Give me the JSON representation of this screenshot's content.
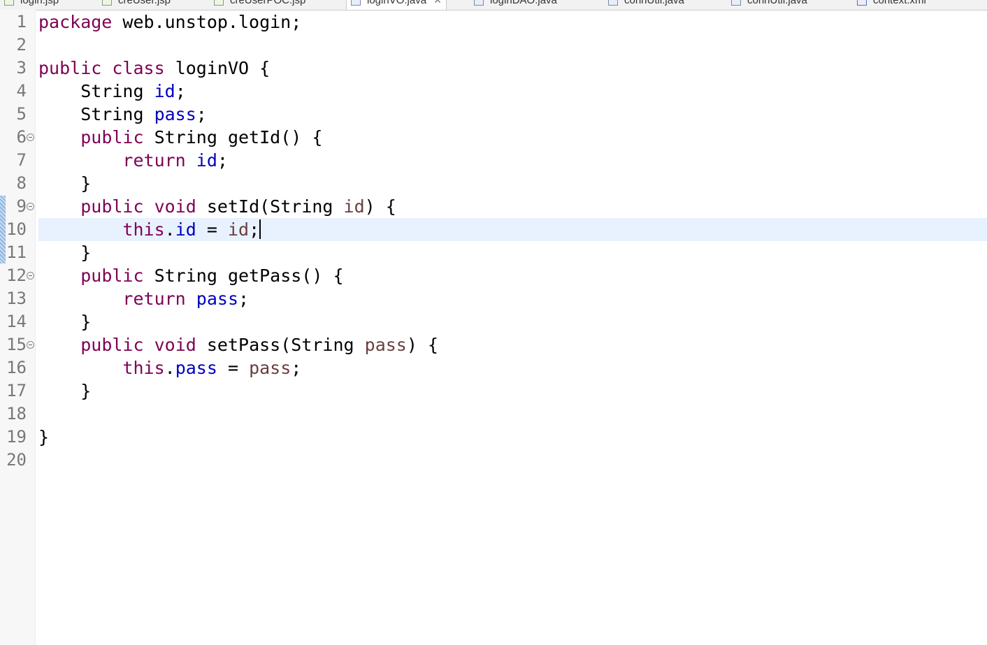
{
  "tabs": [
    {
      "label": "login.jsp",
      "type": "jsp",
      "active": false
    },
    {
      "label": "creUser.jsp",
      "type": "jsp",
      "active": false
    },
    {
      "label": "creUserPOC.jsp",
      "type": "jsp",
      "active": false
    },
    {
      "label": "loginVO.java",
      "type": "java",
      "active": true
    },
    {
      "label": "loginDAO.java",
      "type": "java",
      "active": false
    },
    {
      "label": "connUtil.java",
      "type": "java",
      "active": false
    },
    {
      "label": "connUtil.java",
      "type": "java",
      "active": false
    },
    {
      "label": "context.xml",
      "type": "xml",
      "active": false
    }
  ],
  "editor": {
    "current_line": 10,
    "lines": [
      {
        "n": "1",
        "fold": false,
        "tokens": [
          {
            "t": "package",
            "c": "kw"
          },
          {
            "t": " web.unstop.login;",
            "c": ""
          }
        ]
      },
      {
        "n": "2",
        "fold": false,
        "tokens": []
      },
      {
        "n": "3",
        "fold": false,
        "tokens": [
          {
            "t": "public",
            "c": "kw"
          },
          {
            "t": " ",
            "c": ""
          },
          {
            "t": "class",
            "c": "kw"
          },
          {
            "t": " loginVO {",
            "c": ""
          }
        ]
      },
      {
        "n": "4",
        "fold": false,
        "tokens": [
          {
            "t": "    String ",
            "c": ""
          },
          {
            "t": "id",
            "c": "fld"
          },
          {
            "t": ";",
            "c": ""
          }
        ]
      },
      {
        "n": "5",
        "fold": false,
        "tokens": [
          {
            "t": "    String ",
            "c": ""
          },
          {
            "t": "pass",
            "c": "fld"
          },
          {
            "t": ";",
            "c": ""
          }
        ]
      },
      {
        "n": "6",
        "fold": true,
        "tokens": [
          {
            "t": "    ",
            "c": ""
          },
          {
            "t": "public",
            "c": "kw"
          },
          {
            "t": " String getId() {",
            "c": ""
          }
        ]
      },
      {
        "n": "7",
        "fold": false,
        "tokens": [
          {
            "t": "        ",
            "c": ""
          },
          {
            "t": "return",
            "c": "kw"
          },
          {
            "t": " ",
            "c": ""
          },
          {
            "t": "id",
            "c": "fld"
          },
          {
            "t": ";",
            "c": ""
          }
        ]
      },
      {
        "n": "8",
        "fold": false,
        "tokens": [
          {
            "t": "    }",
            "c": ""
          }
        ]
      },
      {
        "n": "9",
        "fold": true,
        "tokens": [
          {
            "t": "    ",
            "c": ""
          },
          {
            "t": "public",
            "c": "kw"
          },
          {
            "t": " ",
            "c": ""
          },
          {
            "t": "void",
            "c": "kw"
          },
          {
            "t": " setId(String ",
            "c": ""
          },
          {
            "t": "id",
            "c": "param"
          },
          {
            "t": ") {",
            "c": ""
          }
        ]
      },
      {
        "n": "10",
        "fold": false,
        "tokens": [
          {
            "t": "        ",
            "c": ""
          },
          {
            "t": "this",
            "c": "kw"
          },
          {
            "t": ".",
            "c": ""
          },
          {
            "t": "id",
            "c": "fld"
          },
          {
            "t": " = ",
            "c": ""
          },
          {
            "t": "id",
            "c": "param"
          },
          {
            "t": ";",
            "c": ""
          }
        ]
      },
      {
        "n": "11",
        "fold": false,
        "tokens": [
          {
            "t": "    }",
            "c": ""
          }
        ]
      },
      {
        "n": "12",
        "fold": true,
        "tokens": [
          {
            "t": "    ",
            "c": ""
          },
          {
            "t": "public",
            "c": "kw"
          },
          {
            "t": " String getPass() {",
            "c": ""
          }
        ]
      },
      {
        "n": "13",
        "fold": false,
        "tokens": [
          {
            "t": "        ",
            "c": ""
          },
          {
            "t": "return",
            "c": "kw"
          },
          {
            "t": " ",
            "c": ""
          },
          {
            "t": "pass",
            "c": "fld"
          },
          {
            "t": ";",
            "c": ""
          }
        ]
      },
      {
        "n": "14",
        "fold": false,
        "tokens": [
          {
            "t": "    }",
            "c": ""
          }
        ]
      },
      {
        "n": "15",
        "fold": true,
        "tokens": [
          {
            "t": "    ",
            "c": ""
          },
          {
            "t": "public",
            "c": "kw"
          },
          {
            "t": " ",
            "c": ""
          },
          {
            "t": "void",
            "c": "kw"
          },
          {
            "t": " setPass(String ",
            "c": ""
          },
          {
            "t": "pass",
            "c": "param"
          },
          {
            "t": ") {",
            "c": ""
          }
        ]
      },
      {
        "n": "16",
        "fold": false,
        "tokens": [
          {
            "t": "        ",
            "c": ""
          },
          {
            "t": "this",
            "c": "kw"
          },
          {
            "t": ".",
            "c": ""
          },
          {
            "t": "pass",
            "c": "fld"
          },
          {
            "t": " = ",
            "c": ""
          },
          {
            "t": "pass",
            "c": "param"
          },
          {
            "t": ";",
            "c": ""
          }
        ]
      },
      {
        "n": "17",
        "fold": false,
        "tokens": [
          {
            "t": "    }",
            "c": ""
          }
        ]
      },
      {
        "n": "18",
        "fold": false,
        "tokens": []
      },
      {
        "n": "19",
        "fold": false,
        "tokens": [
          {
            "t": "}",
            "c": ""
          }
        ]
      },
      {
        "n": "20",
        "fold": false,
        "tokens": []
      }
    ]
  },
  "colors": {
    "keyword": "#7f0055",
    "field": "#0000c0",
    "parameter": "#6a3e3e",
    "current_line_highlight": "#e8f2fe"
  },
  "icons": {
    "tab_file": "java-file-icon",
    "tab_close": "close-icon",
    "fold": "fold-collapse-icon"
  }
}
